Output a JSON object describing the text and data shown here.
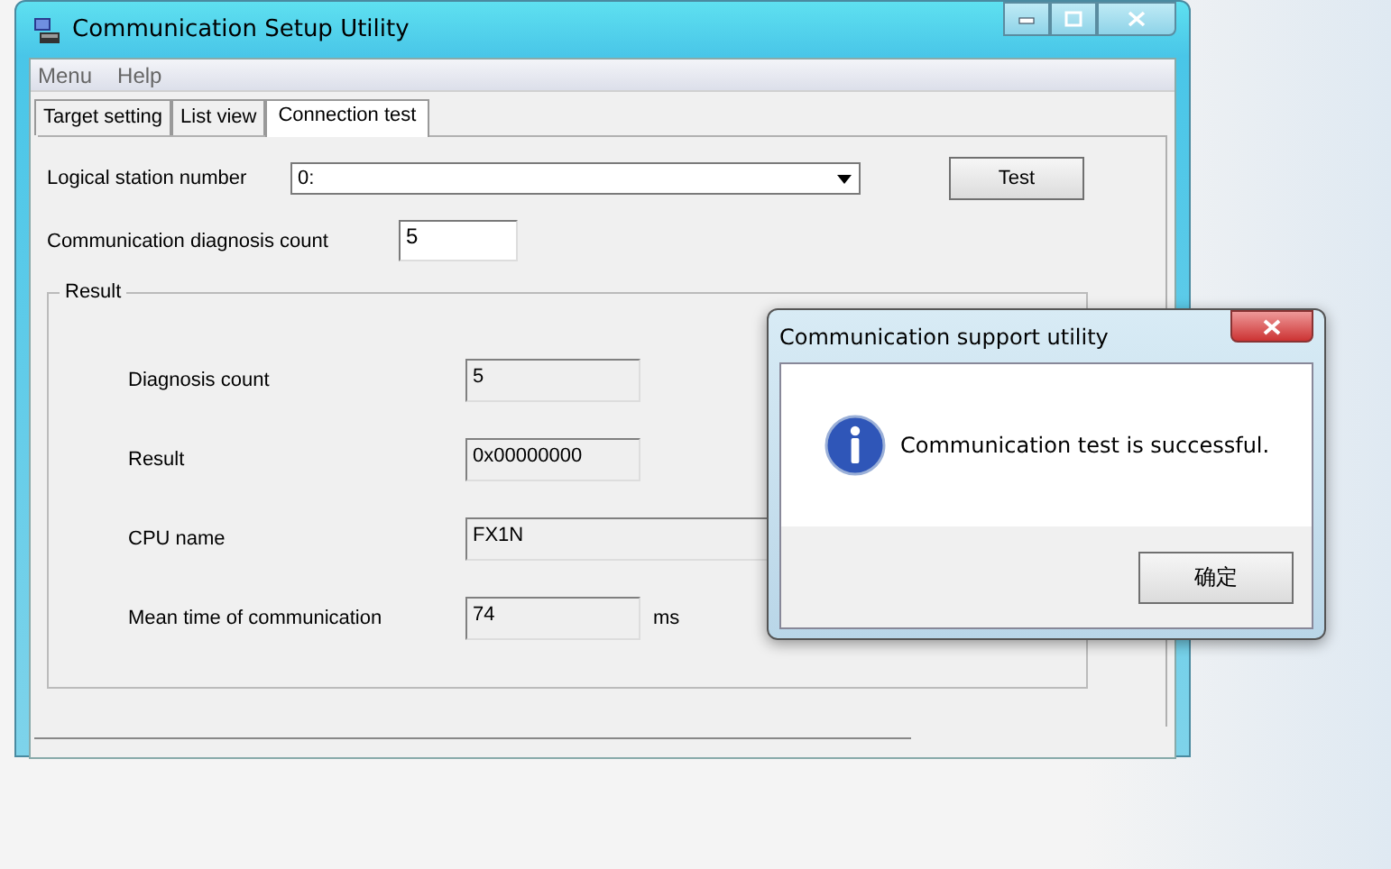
{
  "window": {
    "title": "Communication Setup Utility"
  },
  "menu": [
    "Menu",
    "Help"
  ],
  "tabs": [
    {
      "label": "Target setting",
      "selected": false
    },
    {
      "label": "List view",
      "selected": false
    },
    {
      "label": "Connection test",
      "selected": true
    }
  ],
  "logical_station": {
    "label": "Logical station number",
    "value": "0:"
  },
  "test_button": "Test",
  "diagnosis_count_setting": {
    "label": "Communication diagnosis count",
    "value": "5"
  },
  "result": {
    "title": "Result",
    "rows": [
      {
        "label": "Diagnosis count",
        "value": "5",
        "kind": "short"
      },
      {
        "label": "Result",
        "value": "0x00000000",
        "kind": "short"
      },
      {
        "label": "CPU name",
        "value": "FX1N",
        "kind": "wide"
      },
      {
        "label": "Mean time of communication",
        "value": "74",
        "unit": "ms",
        "kind": "short"
      }
    ]
  },
  "dialog": {
    "title": "Communication support utility",
    "message": "Communication test is successful.",
    "button": "确定"
  }
}
